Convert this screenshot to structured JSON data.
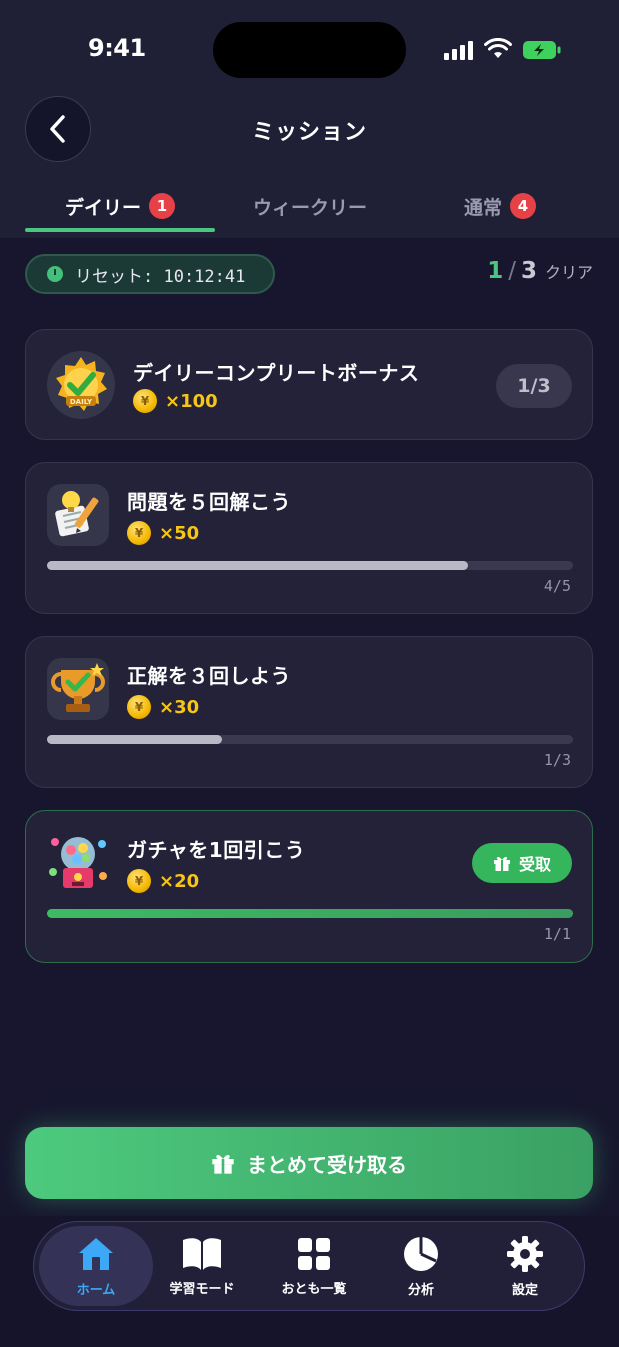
{
  "status_bar": {
    "time": "9:41"
  },
  "header": {
    "title": "ミッション"
  },
  "tabs": [
    {
      "label": "デイリー",
      "badge": "1",
      "active": true
    },
    {
      "label": "ウィークリー",
      "badge": "",
      "active": false
    },
    {
      "label": "通常",
      "badge": "4",
      "active": false
    }
  ],
  "reset": {
    "text": "リセット: 10:12:41"
  },
  "clear_summary": {
    "done": "1",
    "sep": "/",
    "total": "3",
    "label": "クリア"
  },
  "bonus_card": {
    "title": "デイリーコンプリートボーナス",
    "reward": "×100",
    "count": "1/3",
    "badge_text": "DAILY"
  },
  "missions": [
    {
      "title": "問題を５回解こう",
      "reward": "×50",
      "progress_text": "4/5",
      "progress": 0.8,
      "icon": "lightbulb-pencil-icon"
    },
    {
      "title": "正解を３回しよう",
      "reward": "×30",
      "progress_text": "1/3",
      "progress": 0.333,
      "icon": "trophy-icon"
    },
    {
      "title": "ガチャを1回引こう",
      "reward": "×20",
      "progress_text": "1/1",
      "progress": 1.0,
      "icon": "gacha-machine-icon",
      "claim_label": "受取"
    }
  ],
  "coin_symbol": "¥",
  "claim_all": {
    "label": "まとめて受け取る"
  },
  "nav": [
    {
      "label": "ホーム",
      "icon": "home-icon",
      "active": true
    },
    {
      "label": "学習モード",
      "icon": "book-icon",
      "active": false
    },
    {
      "label": "おとも一覧",
      "icon": "grid-icon",
      "active": false
    },
    {
      "label": "分析",
      "icon": "pie-chart-icon",
      "active": false
    },
    {
      "label": "設定",
      "icon": "gear-icon",
      "active": false
    }
  ],
  "colors": {
    "accent_green": "#4cc581",
    "badge_red": "#e74148",
    "coin_gold": "#f5c518",
    "nav_active_blue": "#3da8f5"
  }
}
